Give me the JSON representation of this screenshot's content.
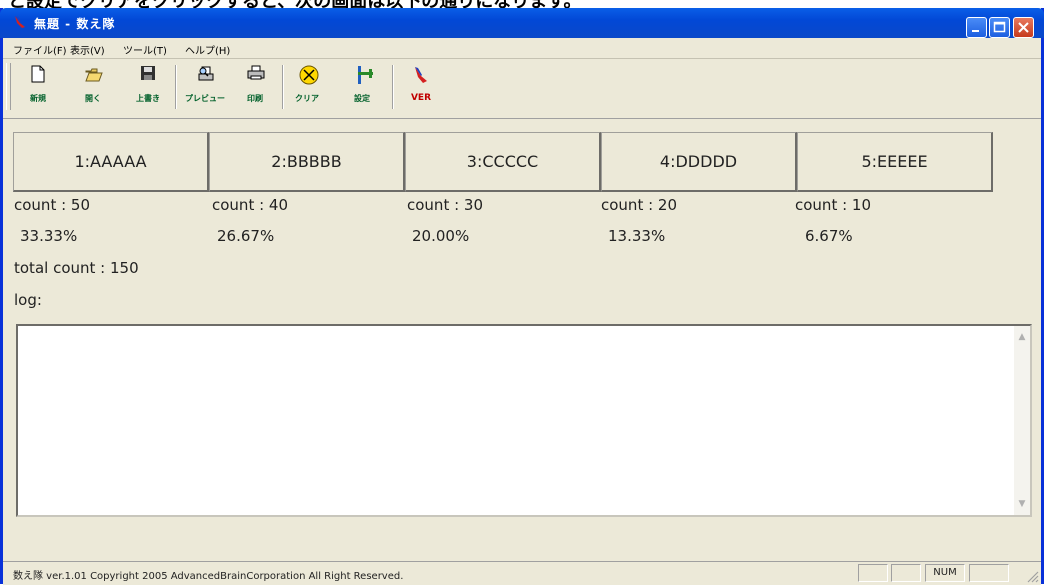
{
  "window": {
    "title": "無題 - 数え隊",
    "accent_color": "#0a5fe8",
    "controls": [
      "minimize",
      "maximize",
      "close"
    ]
  },
  "menu": [
    {
      "label": "ファイル(F)"
    },
    {
      "label": "表示(V)"
    },
    {
      "label": "ツール(T)"
    },
    {
      "label": "ヘルプ(H)"
    }
  ],
  "toolbar": [
    {
      "label": "新規",
      "icon": "new-document-icon"
    },
    {
      "label": "開く",
      "icon": "open-folder-icon"
    },
    {
      "label": "上書き",
      "icon": "save-disk-icon"
    },
    {
      "label": "プレビュー",
      "icon": "print-preview-icon"
    },
    {
      "label": "印刷",
      "icon": "printer-icon"
    },
    {
      "label": "クリア",
      "icon": "clear-circle-icon"
    },
    {
      "label": "設定",
      "icon": "settings-icon"
    },
    {
      "label": "VER",
      "icon": "version-icon"
    }
  ],
  "categories": [
    {
      "label": "1:AAAAA",
      "count_text": "count : 50",
      "percent": "33.33%"
    },
    {
      "label": "2:BBBBB",
      "count_text": "count : 40",
      "percent": "26.67%"
    },
    {
      "label": "3:CCCCC",
      "count_text": "count : 30",
      "percent": "20.00%"
    },
    {
      "label": "4:DDDDD",
      "count_text": "count : 20",
      "percent": "13.33%"
    },
    {
      "label": "5:EEEEE",
      "count_text": "count : 10",
      "percent": "6.67%"
    }
  ],
  "total_text": "total count : 150",
  "log_label": "log:",
  "log_value": "",
  "status": {
    "text": "数え隊 ver.1.01 Copyright 2005 AdvancedBrainCorporation All Right Reserved.",
    "num_indicator": "NUM"
  },
  "page_caption": "と設定でクリアをクリックすると、次の画面は以下の通りになります。"
}
